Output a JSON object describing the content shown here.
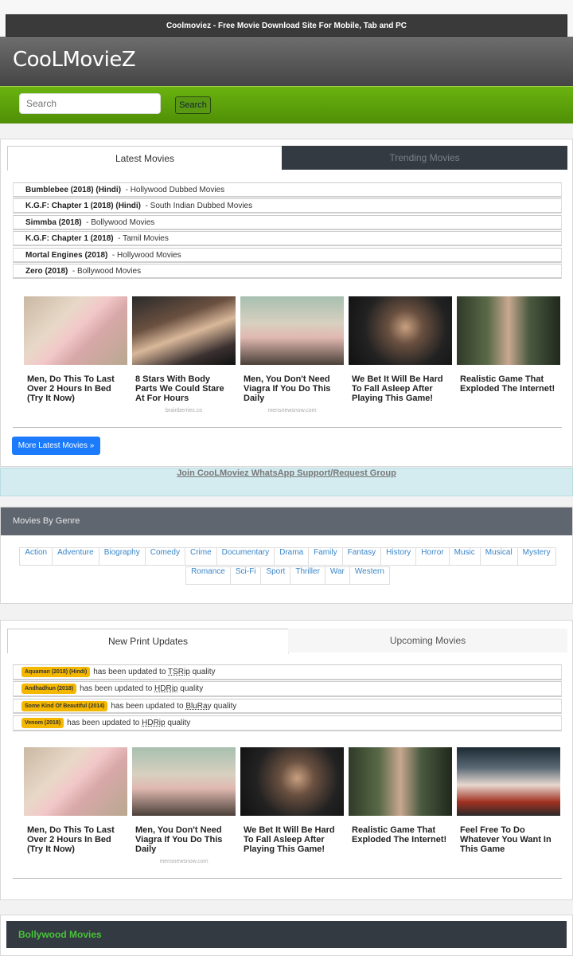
{
  "header": {
    "strip_text": "Coolmoviez - Free Movie Download Site For Mobile, Tab and PC",
    "site_name": "CooLMovieZ"
  },
  "search": {
    "placeholder": "Search",
    "button_label": "Search"
  },
  "latest": {
    "tabs": [
      "Latest Movies",
      "Trending Movies"
    ],
    "items": [
      {
        "title": "Bumblebee (2018) (Hindi)",
        "category": "- Hollywood Dubbed Movies"
      },
      {
        "title": "K.G.F: Chapter 1 (2018) (Hindi)",
        "category": "- South Indian Dubbed Movies"
      },
      {
        "title": "Simmba (2018)",
        "category": "- Bollywood Movies"
      },
      {
        "title": "K.G.F: Chapter 1 (2018)",
        "category": "- Tamil Movies"
      },
      {
        "title": "Mortal Engines (2018)",
        "category": "- Hollywood Movies"
      },
      {
        "title": "Zero (2018)",
        "category": "- Bollywood Movies"
      }
    ],
    "ads": [
      {
        "caption": "Men, Do This To Last Over 2 Hours In Bed (Try It Now)",
        "source": ""
      },
      {
        "caption": "8 Stars With Body Parts We Could Stare At For Hours",
        "source": "brainberries.co"
      },
      {
        "caption": "Men, You Don't Need Viagra If You Do This Daily",
        "source": "mensnewsnow.com"
      },
      {
        "caption": "We Bet It Will Be Hard To Fall Asleep After Playing This Game!",
        "source": ""
      },
      {
        "caption": "Realistic Game That Exploded The Internet!",
        "source": ""
      }
    ],
    "more_button": "More Latest Movies »"
  },
  "whatsapp_link": "Join CooLMoviez WhatsApp Support/Request Group",
  "genres": {
    "heading": "Movies By Genre",
    "items": [
      "Action",
      "Adventure",
      "Biography",
      "Comedy",
      "Crime",
      "Documentary",
      "Drama",
      "Family",
      "Fantasy",
      "History",
      "Horror",
      "Music",
      "Musical",
      "Mystery",
      "Romance",
      "Sci-Fi",
      "Sport",
      "Thriller",
      "War",
      "Western"
    ]
  },
  "updates": {
    "tabs": [
      "New Print Updates",
      "Upcoming Movies"
    ],
    "items": [
      {
        "title": "Aquaman (2018) (Hindi)",
        "text": "has been updated to",
        "quality": "TSRip",
        "suffix": "quality"
      },
      {
        "title": "Andhadhun (2018)",
        "text": "has been updated to",
        "quality": "HDRip",
        "suffix": "quality"
      },
      {
        "title": "Some Kind Of Beautiful (2014)",
        "text": "has been updated to",
        "quality": "BluRay",
        "suffix": "quality"
      },
      {
        "title": "Venom (2018)",
        "text": "has been updated to",
        "quality": "HDRip",
        "suffix": "quality"
      }
    ],
    "ads": [
      {
        "caption": "Men, Do This To Last Over 2 Hours In Bed (Try It Now)",
        "source": ""
      },
      {
        "caption": "Men, You Don't Need Viagra If You Do This Daily",
        "source": "mensnewsnow.com"
      },
      {
        "caption": "We Bet It Will Be Hard To Fall Asleep After Playing This Game!",
        "source": ""
      },
      {
        "caption": "Realistic Game That Exploded The Internet!",
        "source": ""
      },
      {
        "caption": "Feel Free To Do Whatever You Want In This Game",
        "source": ""
      }
    ]
  },
  "bollywood_heading": "Bollywood Movies",
  "colors": {
    "green_bar": "#5ea00b",
    "button_blue": "#1b7bfb",
    "badge": "#f5b800",
    "dark_tab": "#333a42"
  }
}
